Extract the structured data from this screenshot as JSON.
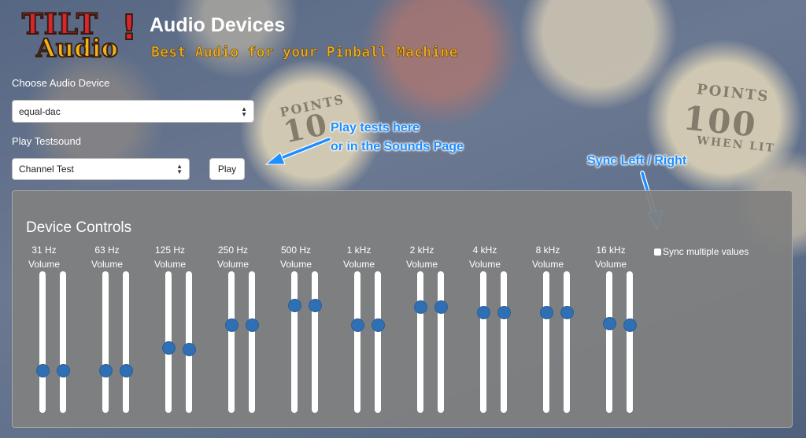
{
  "header": {
    "logo_text_top": "TILT",
    "logo_text_bottom": "Audio",
    "logo_mark": "!",
    "title": "Audio Devices",
    "tagline": "Best Audio for your Pinball Machine"
  },
  "device_select": {
    "label": "Choose Audio Device",
    "value": "equal-dac"
  },
  "testsound": {
    "label": "Play Testsound",
    "value": "Channel Test",
    "play_label": "Play"
  },
  "annotations": {
    "play_hint_line1": "Play tests here",
    "play_hint_line2": "or in the Sounds Page",
    "sync_hint": "Sync Left / Right"
  },
  "controls": {
    "title": "Device Controls",
    "sync_label": "Sync multiple values",
    "volume_label": "Volume",
    "bands": [
      {
        "freq": "31 Hz",
        "left": 0.3,
        "right": 0.3
      },
      {
        "freq": "63 Hz",
        "left": 0.3,
        "right": 0.3
      },
      {
        "freq": "125 Hz",
        "left": 0.46,
        "right": 0.45
      },
      {
        "freq": "250 Hz",
        "left": 0.62,
        "right": 0.62
      },
      {
        "freq": "500 Hz",
        "left": 0.76,
        "right": 0.76
      },
      {
        "freq": "1 kHz",
        "left": 0.62,
        "right": 0.62
      },
      {
        "freq": "2 kHz",
        "left": 0.75,
        "right": 0.75
      },
      {
        "freq": "4 kHz",
        "left": 0.71,
        "right": 0.71
      },
      {
        "freq": "8 kHz",
        "left": 0.71,
        "right": 0.71
      },
      {
        "freq": "16 kHz",
        "left": 0.63,
        "right": 0.62
      }
    ]
  },
  "background_text": {
    "points_1": "POINTS",
    "value_1": "10",
    "points_2": "POINTS",
    "value_2": "100",
    "when_lit": "WHEN LIT"
  },
  "colors": {
    "accent": "#2f6fb3",
    "annotation": "#1e8fff",
    "tagline": "#f2b21a",
    "logo_red": "#d8262d"
  }
}
